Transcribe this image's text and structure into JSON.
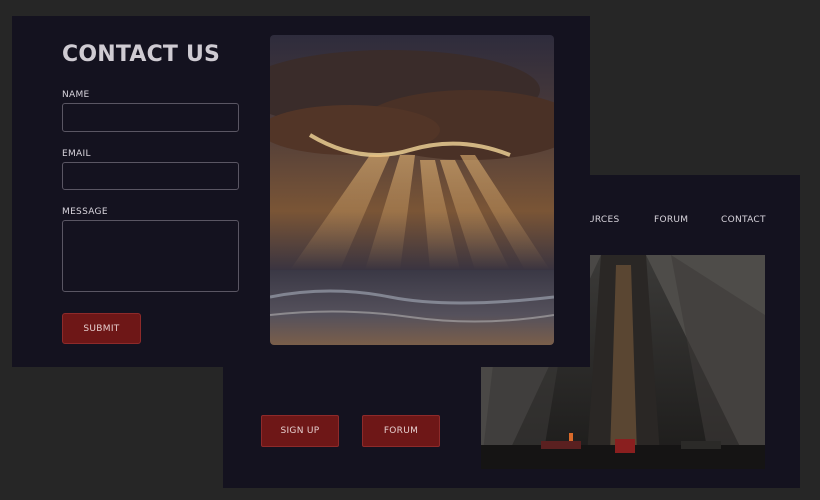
{
  "contact": {
    "title": "CONTACT US",
    "name_label": "NAME",
    "name_value": "",
    "email_label": "EMAIL",
    "email_value": "",
    "message_label": "MESSAGE",
    "message_value": "",
    "submit_label": "SUBMIT"
  },
  "back": {
    "nav": {
      "resources": "RESOURCES",
      "forum": "FORUM",
      "contact": "CONTACT"
    },
    "signup_label": "SIGN UP",
    "forum_label": "FORUM"
  },
  "colors": {
    "background": "#262626",
    "panel": "#14121f",
    "accent_button": "#6e1717",
    "text": "#cfcbd2"
  }
}
